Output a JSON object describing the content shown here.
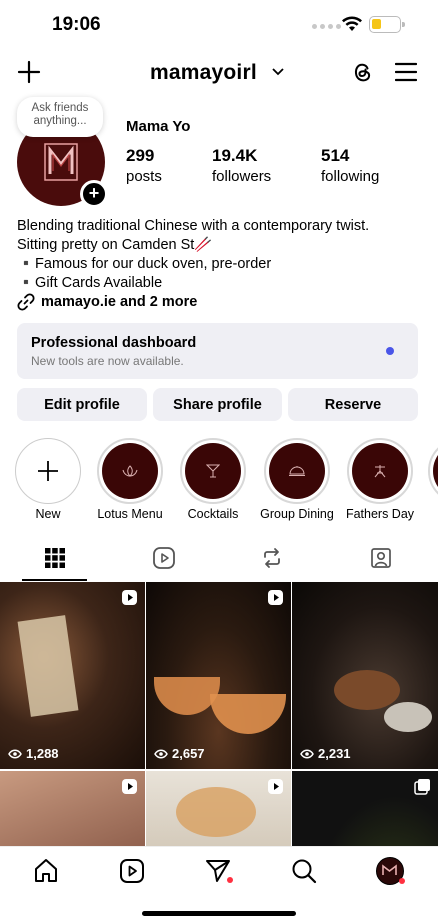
{
  "status_bar": {
    "time": "19:06"
  },
  "header": {
    "username": "mamayoirl"
  },
  "profile": {
    "note": "Ask friends anything...",
    "display_name": "Mama Yo",
    "stats": [
      {
        "value": "299",
        "label": "posts"
      },
      {
        "value": "19.4K",
        "label": "followers"
      },
      {
        "value": "514",
        "label": "following"
      }
    ],
    "bio": [
      "Blending traditional Chinese with a contemporary twist.",
      "Sitting pretty on Camden St🥢",
      "▪️Famous for our duck oven, pre-order",
      "▪️Gift Cards Available"
    ],
    "link_text": "mamayo.ie and 2 more"
  },
  "dashboard": {
    "title": "Professional dashboard",
    "subtitle": "New tools are now available."
  },
  "buttons": {
    "edit": "Edit profile",
    "share": "Share profile",
    "reserve": "Reserve"
  },
  "highlights": [
    {
      "label": "New"
    },
    {
      "label": "Lotus Menu"
    },
    {
      "label": "Cocktails"
    },
    {
      "label": "Group Dining"
    },
    {
      "label": "Fathers Day"
    }
  ],
  "posts": [
    {
      "views": "1,288",
      "type": "reel"
    },
    {
      "views": "2,657",
      "type": "reel"
    },
    {
      "views": "2,231",
      "type": "reel"
    },
    {
      "views": "",
      "type": "reel"
    },
    {
      "views": "",
      "type": "reel"
    },
    {
      "views": "",
      "type": "carousel"
    }
  ],
  "colors": {
    "accent_blue": "#4a55e8",
    "brand_maroon": "#3a0606",
    "notification_red": "#ff3040",
    "button_gray": "#efeff4"
  }
}
